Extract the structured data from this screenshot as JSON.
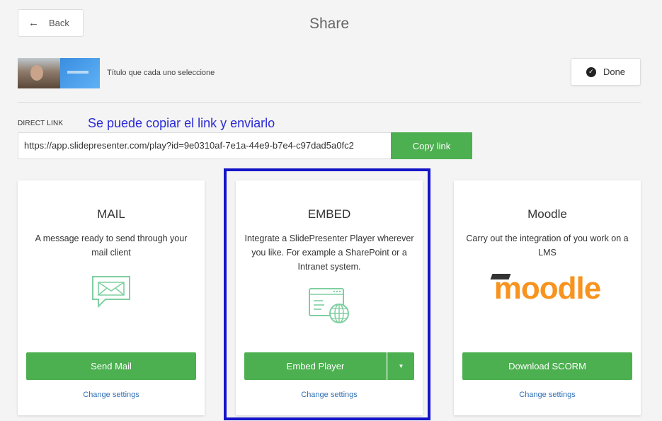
{
  "header": {
    "back_label": "Back",
    "title": "Share"
  },
  "presentation": {
    "title": "Título que cada uno seleccione"
  },
  "done_label": "Done",
  "direct_link": {
    "label": "DIRECT LINK",
    "annotation": "Se puede copiar el link y enviarlo",
    "url": "https://app.slidepresenter.com/play?id=9e0310af-7e1a-44e9-b7e4-c97dad5a0fc2",
    "copy_label": "Copy link"
  },
  "cards": {
    "mail": {
      "title": "MAIL",
      "description": "A message ready to send through your mail client",
      "button": "Send Mail",
      "settings": "Change settings",
      "icon": "mail-chat-icon"
    },
    "embed": {
      "title": "EMBED",
      "description": "Integrate a SlidePresenter Player wherever you like. For example a SharePoint or a Intranet system.",
      "button": "Embed Player",
      "settings": "Change settings",
      "icon": "browser-globe-icon"
    },
    "moodle": {
      "title": "Moodle",
      "description": "Carry out the integration of you work on a LMS",
      "logo_text": "moodle",
      "button": "Download SCORM",
      "settings": "Change settings"
    }
  },
  "colors": {
    "primary_green": "#4caf50",
    "link_blue": "#2f6fb5",
    "highlight_blue": "#1414c8",
    "moodle_orange": "#f7931e",
    "icon_green": "#7fcfa0"
  }
}
